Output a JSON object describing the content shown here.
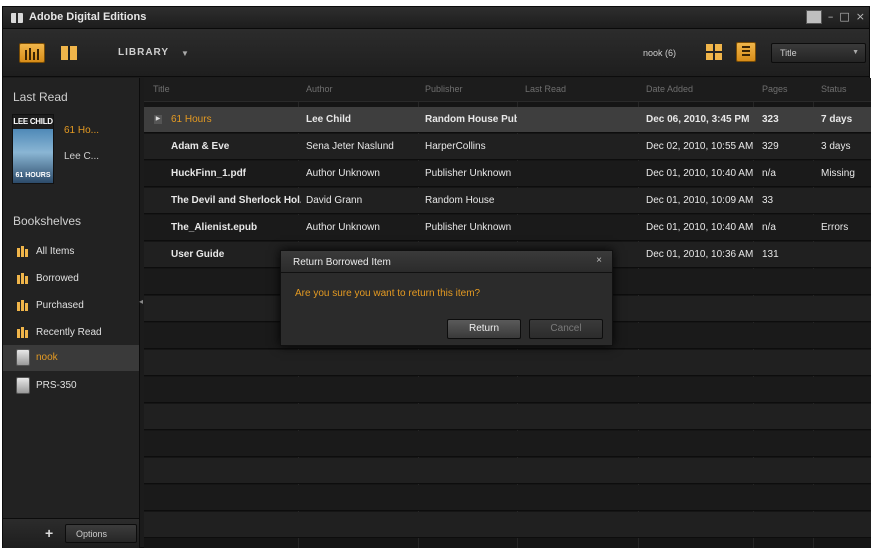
{
  "window": {
    "title": "Adobe Digital Editions",
    "controls": {
      "minimize": "–",
      "maximize": "□",
      "close": "×"
    }
  },
  "toolbar": {
    "library_label": "LIBRARY",
    "library_arrow": "▼",
    "device_label": "nook (6)",
    "sort_label": "Title",
    "sort_arrow": "▼"
  },
  "sidebar": {
    "last_read_heading": "Last Read",
    "last_read": {
      "cover_author": "LEE CHILD",
      "cover_title": "61 HOURS",
      "title": "61 Ho...",
      "author": "Lee C..."
    },
    "bookshelves_heading": "Bookshelves",
    "items": [
      {
        "label": "All Items",
        "icon": "shelf-icon",
        "selected": false
      },
      {
        "label": "Borrowed",
        "icon": "shelf-icon",
        "selected": false
      },
      {
        "label": "Purchased",
        "icon": "shelf-icon",
        "selected": false
      },
      {
        "label": "Recently Read",
        "icon": "shelf-icon",
        "selected": false
      },
      {
        "label": "nook",
        "icon": "device-icon",
        "selected": true
      },
      {
        "label": "PRS-350",
        "icon": "device-icon",
        "selected": false
      }
    ],
    "add_label": "+",
    "options_label": "Options"
  },
  "table": {
    "columns": [
      "Title",
      "Author",
      "Publisher",
      "Last Read",
      "Date Added",
      "Pages",
      "Status"
    ],
    "rows": [
      {
        "title": "61 Hours",
        "author": "Lee Child",
        "publisher": "Random House Publi",
        "last_read": "",
        "date_added": "Dec 06, 2010, 3:45 PM",
        "pages": "323",
        "status": "7 days",
        "selected": true
      },
      {
        "title": "Adam & Eve",
        "author": "Sena Jeter Naslund",
        "publisher": "HarperCollins",
        "last_read": "",
        "date_added": "Dec 02, 2010, 10:55 AM",
        "pages": "329",
        "status": "3 days",
        "selected": false
      },
      {
        "title": "HuckFinn_1.pdf",
        "author": "Author Unknown",
        "publisher": "Publisher Unknown",
        "last_read": "",
        "date_added": "Dec 01, 2010, 10:40 AM",
        "pages": "n/a",
        "status": "Missing",
        "selected": false
      },
      {
        "title": "The Devil and Sherlock Hol...",
        "author": "David Grann",
        "publisher": "Random House",
        "last_read": "",
        "date_added": "Dec 01, 2010, 10:09 AM",
        "pages": "33",
        "status": "",
        "selected": false
      },
      {
        "title": "The_Alienist.epub",
        "author": "Author Unknown",
        "publisher": "Publisher Unknown",
        "last_read": "",
        "date_added": "Dec 01, 2010, 10:40 AM",
        "pages": "n/a",
        "status": "Errors",
        "selected": false
      },
      {
        "title": "User Guide",
        "author": "",
        "publisher": "",
        "last_read": "",
        "date_added": "Dec 01, 2010, 10:36 AM",
        "pages": "131",
        "status": "",
        "selected": false
      }
    ]
  },
  "dialog": {
    "title": "Return Borrowed Item",
    "close": "×",
    "message": "Are you sure you want to return this item?",
    "return_label": "Return",
    "cancel_label": "Cancel"
  },
  "colors": {
    "accent": "#e49a22",
    "background": "#1b1b1b"
  }
}
